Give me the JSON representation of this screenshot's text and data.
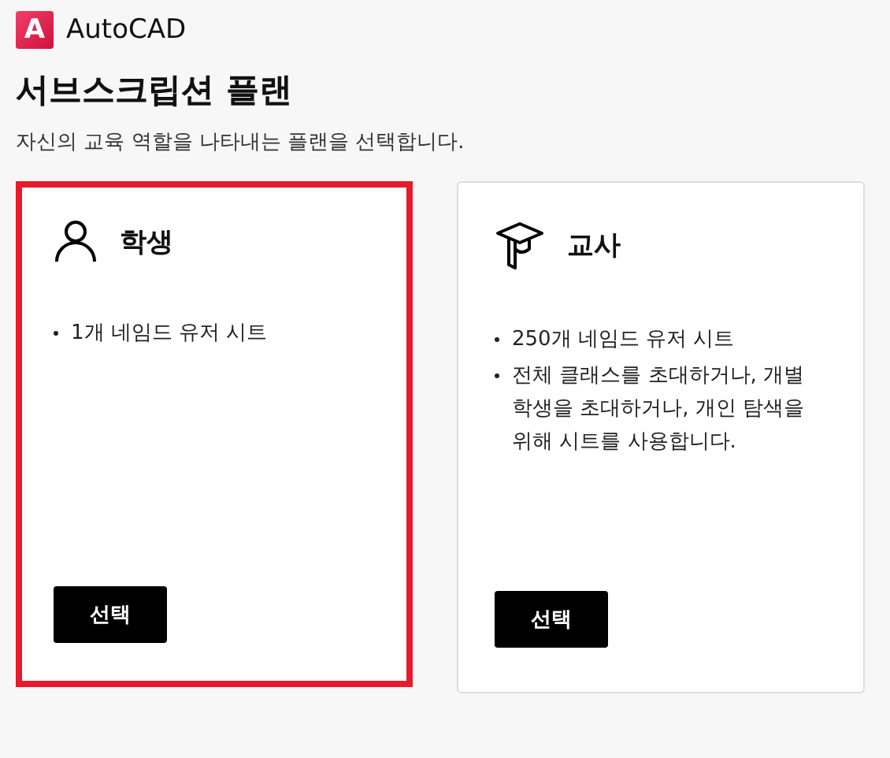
{
  "app": {
    "logo_letter": "A",
    "name": "AutoCAD"
  },
  "heading": "서브스크립션 플랜",
  "subtitle": "자신의 교육 역할을 나타내는 플랜을 선택합니다.",
  "plans": [
    {
      "kind": "student",
      "title": "학생",
      "selected": true,
      "features": [
        "1개 네임드 유저 시트"
      ],
      "button": "선택"
    },
    {
      "kind": "teacher",
      "title": "교사",
      "selected": false,
      "features": [
        "250개 네임드 유저 시트",
        "전체 클래스를 초대하거나, 개별 학생을 초대하거나, 개인 탐색을 위해 시트를 사용합니다."
      ],
      "button": "선택"
    }
  ]
}
